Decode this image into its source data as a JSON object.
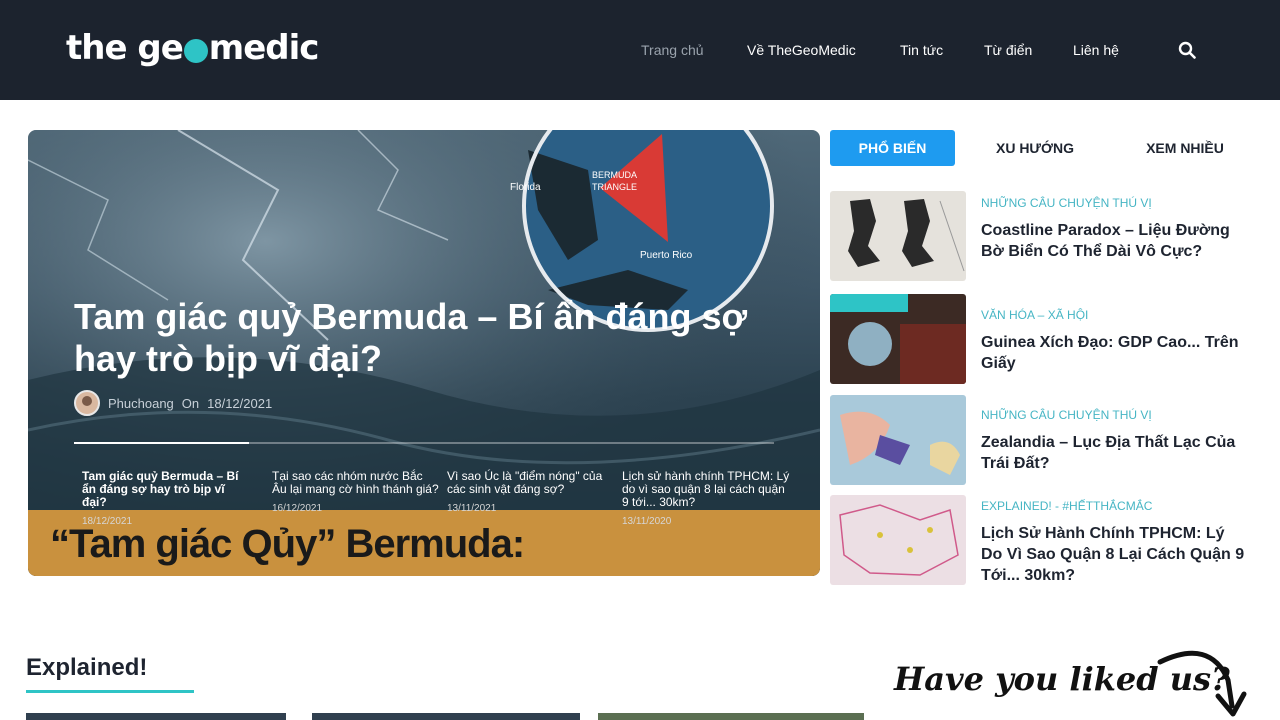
{
  "header": {
    "logo": {
      "part1": "the ge",
      "part2": "medic"
    },
    "nav": [
      {
        "label": "Trang chủ",
        "active": true
      },
      {
        "label": "Về TheGeoMedic"
      },
      {
        "label": "Tin tức"
      },
      {
        "label": "Từ điển"
      },
      {
        "label": "Liên hệ"
      }
    ],
    "search_icon": "search-icon"
  },
  "hero": {
    "title": "Tam giác quỷ Bermuda – Bí ẩn đáng sợ hay trò bịp vĩ đại?",
    "author": "Phuchoang",
    "on": "On",
    "date": "18/12/2021",
    "progress": 0.25,
    "map_labels": {
      "florida": "Florida",
      "bermuda1": "BERMUDA",
      "bermuda2": "TRIANGLE",
      "puerto": "Puerto Rico"
    },
    "slides": [
      {
        "title": "Tam giác quỷ Bermuda – Bí ẩn đáng sợ hay trò bịp vĩ đại?",
        "date": "18/12/2021"
      },
      {
        "title": "Tại sao các nhóm nước Bắc Âu lại mang cờ hình thánh giá?",
        "date": "16/12/2021"
      },
      {
        "title": "Vì sao Úc là \"điểm nóng\" của các sinh vật đáng sợ?",
        "date": "13/11/2021"
      },
      {
        "title": "Lịch sử hành chính TPHCM: Lý do vì sao quận 8 lại cách quận 9 tới... 30km?",
        "date": "13/11/2020"
      }
    ],
    "banner": "“Tam giác Qủy” Bermuda:"
  },
  "tabs": [
    {
      "label": "PHỔ BIẾN",
      "active": true
    },
    {
      "label": "XU HƯỚNG"
    },
    {
      "label": "XEM NHIỀU"
    }
  ],
  "posts": [
    {
      "category": "NHỮNG CÂU CHUYỆN THÚ VỊ",
      "title": "Coastline Paradox – Liệu Đường Bờ Biển Có Thể Dài Vô Cực?"
    },
    {
      "category": "VĂN HÓA – XÃ HỘI",
      "title": "Guinea Xích Đạo: GDP Cao... Trên Giấy"
    },
    {
      "category": "NHỮNG CÂU CHUYỆN THÚ VỊ",
      "title": "Zealandia – Lục Địa Thất Lạc Của Trái Đất?"
    },
    {
      "category": "EXPLAINED! - #HẾTTHẮCMẮC",
      "title": "Lịch Sử Hành Chính TPHCM: Lý Do Vì Sao Quận 8 Lại Cách Quận 9 Tới... 30km?"
    }
  ],
  "section": {
    "title": "Explained!"
  },
  "widget": {
    "liked": "Have you liked us?"
  },
  "colors": {
    "header_bg": "#1c232e",
    "accent": "#2ec4c6",
    "tab_active": "#1e9bf0",
    "category": "#46b5c4",
    "banner": "#c9913e"
  }
}
